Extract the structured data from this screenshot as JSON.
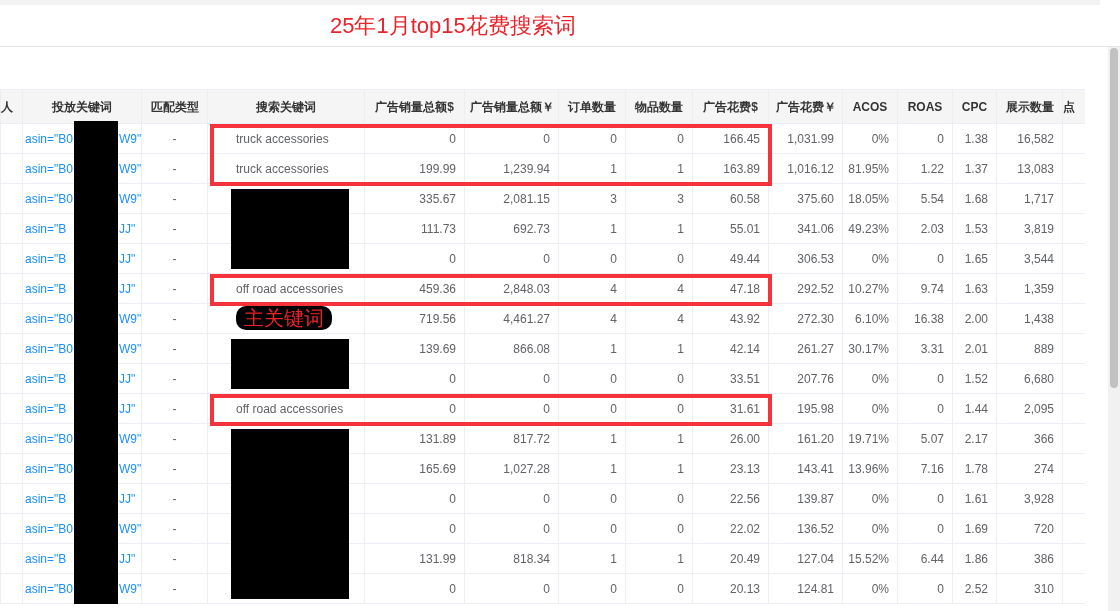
{
  "title": "25年1月top15花费搜索词",
  "table": {
    "columns": [
      "人",
      "投放关键词",
      "匹配类型",
      "搜索关键词",
      "广告销量总额$",
      "广告销量总额￥",
      "订单数量",
      "物品数量",
      "广告花费$",
      "广告花费￥",
      "ACOS",
      "ROAS",
      "CPC",
      "展示数量",
      "点"
    ],
    "rows": [
      {
        "redacted": false,
        "highlighted": true,
        "cells": [
          "",
          {
            "prefix": "asin=\"B0",
            "suffix": "W9\""
          },
          "-",
          "truck accessories",
          "0",
          "0",
          "0",
          "0",
          "166.45",
          "1,031.99",
          "0%",
          "0",
          "1.38",
          "16,582",
          ""
        ]
      },
      {
        "redacted": false,
        "highlighted": true,
        "cells": [
          "",
          {
            "prefix": "asin=\"B0",
            "suffix": "W9\""
          },
          "-",
          "truck accessories",
          "199.99",
          "1,239.94",
          "1",
          "1",
          "163.89",
          "1,016.12",
          "81.95%",
          "1.22",
          "1.37",
          "13,083",
          ""
        ]
      },
      {
        "redacted": true,
        "highlighted": false,
        "cells": [
          "",
          {
            "prefix": "asin=\"B0",
            "suffix": "W9\""
          },
          "-",
          "",
          "335.67",
          "2,081.15",
          "3",
          "3",
          "60.58",
          "375.60",
          "18.05%",
          "5.54",
          "1.68",
          "1,717",
          ""
        ]
      },
      {
        "redacted": true,
        "highlighted": false,
        "cells": [
          "",
          {
            "prefix": "asin=\"B",
            "suffix": "JJ\""
          },
          "-",
          "",
          "111.73",
          "692.73",
          "1",
          "1",
          "55.01",
          "341.06",
          "49.23%",
          "2.03",
          "1.53",
          "3,819",
          ""
        ]
      },
      {
        "redacted": true,
        "highlighted": false,
        "cells": [
          "",
          {
            "prefix": "asin=\"B",
            "suffix": "JJ\""
          },
          "-",
          "",
          "0",
          "0",
          "0",
          "0",
          "49.44",
          "306.53",
          "0%",
          "0",
          "1.65",
          "3,544",
          ""
        ]
      },
      {
        "redacted": false,
        "highlighted": true,
        "cells": [
          "",
          {
            "prefix": "asin=\"B",
            "suffix": "JJ\""
          },
          "-",
          "off road accessories",
          "459.36",
          "2,848.03",
          "4",
          "4",
          "47.18",
          "292.52",
          "10.27%",
          "9.74",
          "1.63",
          "1,359",
          ""
        ]
      },
      {
        "redacted": false,
        "highlighted": false,
        "tag": "主关键词",
        "cells": [
          "",
          {
            "prefix": "asin=\"B0",
            "suffix": "W9\""
          },
          "-",
          "",
          "719.56",
          "4,461.27",
          "4",
          "4",
          "43.92",
          "272.30",
          "6.10%",
          "16.38",
          "2.00",
          "1,438",
          ""
        ]
      },
      {
        "redacted": true,
        "highlighted": false,
        "cells": [
          "",
          {
            "prefix": "asin=\"B0",
            "suffix": "W9\""
          },
          "-",
          "",
          "139.69",
          "866.08",
          "1",
          "1",
          "42.14",
          "261.27",
          "30.17%",
          "3.31",
          "2.01",
          "889",
          ""
        ]
      },
      {
        "redacted": true,
        "highlighted": false,
        "cells": [
          "",
          {
            "prefix": "asin=\"B",
            "suffix": "JJ\""
          },
          "-",
          "",
          "0",
          "0",
          "0",
          "0",
          "33.51",
          "207.76",
          "0%",
          "0",
          "1.52",
          "6,680",
          ""
        ]
      },
      {
        "redacted": false,
        "highlighted": true,
        "cells": [
          "",
          {
            "prefix": "asin=\"B",
            "suffix": "JJ\""
          },
          "-",
          "off road accessories",
          "0",
          "0",
          "0",
          "0",
          "31.61",
          "195.98",
          "0%",
          "0",
          "1.44",
          "2,095",
          ""
        ]
      },
      {
        "redacted": true,
        "highlighted": false,
        "cells": [
          "",
          {
            "prefix": "asin=\"B0",
            "suffix": "W9\""
          },
          "-",
          "",
          "131.89",
          "817.72",
          "1",
          "1",
          "26.00",
          "161.20",
          "19.71%",
          "5.07",
          "2.17",
          "366",
          ""
        ]
      },
      {
        "redacted": true,
        "highlighted": false,
        "cells": [
          "",
          {
            "prefix": "asin=\"B0",
            "suffix": "W9\""
          },
          "-",
          "",
          "165.69",
          "1,027.28",
          "1",
          "1",
          "23.13",
          "143.41",
          "13.96%",
          "7.16",
          "1.78",
          "274",
          ""
        ]
      },
      {
        "redacted": true,
        "highlighted": false,
        "cells": [
          "",
          {
            "prefix": "asin=\"B",
            "suffix": "JJ\""
          },
          "-",
          "",
          "0",
          "0",
          "0",
          "0",
          "22.56",
          "139.87",
          "0%",
          "0",
          "1.61",
          "3,928",
          ""
        ]
      },
      {
        "redacted": true,
        "highlighted": false,
        "cells": [
          "",
          {
            "prefix": "asin=\"B0",
            "suffix": "W9\""
          },
          "-",
          "",
          "0",
          "0",
          "0",
          "0",
          "22.02",
          "136.52",
          "0%",
          "0",
          "1.69",
          "720",
          ""
        ]
      },
      {
        "redacted": true,
        "highlighted": false,
        "cells": [
          "",
          {
            "prefix": "asin=\"B",
            "suffix": "JJ\""
          },
          "-",
          "",
          "131.99",
          "818.34",
          "1",
          "1",
          "20.49",
          "127.04",
          "15.52%",
          "6.44",
          "1.86",
          "386",
          ""
        ]
      },
      {
        "redacted": true,
        "highlighted": false,
        "cells": [
          "",
          {
            "prefix": "asin=\"B0",
            "suffix": "W9\""
          },
          "-",
          "",
          "0",
          "0",
          "0",
          "0",
          "20.13",
          "124.81",
          "0%",
          "0",
          "2.52",
          "310",
          ""
        ]
      }
    ]
  }
}
